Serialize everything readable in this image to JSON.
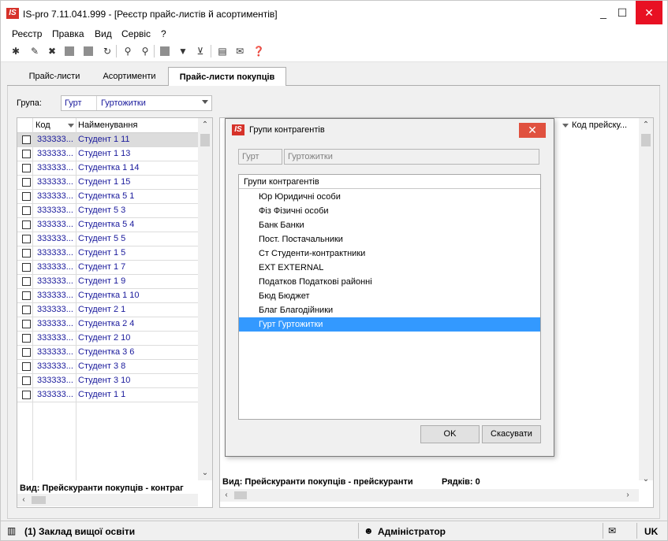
{
  "window": {
    "title": "IS-pro 7.11.041.999 - [Реєстр прайс-листів й асортиментів]",
    "logo": "IS",
    "minimize_icon": "_",
    "maximize_icon": "☐",
    "close_icon": "✕"
  },
  "menu": [
    "Реєстр",
    "Правка",
    "Вид",
    "Сервіс",
    "?"
  ],
  "tabs": [
    "Прайс-листи",
    "Асортименти",
    "Прайс-листи покупців"
  ],
  "group": {
    "label": "Група:",
    "code": "Гурт",
    "name": "Гуртожитки"
  },
  "left_grid": {
    "columns": [
      "Код",
      "Найменування"
    ],
    "rows": [
      {
        "code": "333333...",
        "name": "Студент 1 11"
      },
      {
        "code": "333333...",
        "name": "Студент 1 13"
      },
      {
        "code": "333333...",
        "name": "Студентка 1 14"
      },
      {
        "code": "333333...",
        "name": "Студент 1 15"
      },
      {
        "code": "333333...",
        "name": "Студентка 5 1"
      },
      {
        "code": "333333...",
        "name": "Студент 5 3"
      },
      {
        "code": "333333...",
        "name": "Студентка 5 4"
      },
      {
        "code": "333333...",
        "name": "Студент 5 5"
      },
      {
        "code": "333333...",
        "name": "Студент 1 5"
      },
      {
        "code": "333333...",
        "name": "Студент 1 7"
      },
      {
        "code": "333333...",
        "name": "Студент 1 9"
      },
      {
        "code": "333333...",
        "name": "Студентка 1 10"
      },
      {
        "code": "333333...",
        "name": "Студент 2 1"
      },
      {
        "code": "333333...",
        "name": "Студентка 2 4"
      },
      {
        "code": "333333...",
        "name": "Студент 2 10"
      },
      {
        "code": "333333...",
        "name": "Студентка 3 6"
      },
      {
        "code": "333333...",
        "name": "Студент 3 8"
      },
      {
        "code": "333333...",
        "name": "Студент 3 10"
      },
      {
        "code": "333333...",
        "name": "Студент 1 1"
      }
    ],
    "footer": "Вид: Прейскуранти покупців - контраг"
  },
  "right_grid": {
    "column": "Код прейску...",
    "footer_view": "Вид: Прейскуранти покупців - прейскуранти",
    "footer_rows": "Рядків: 0"
  },
  "dialog": {
    "title": "Групи контрагентів",
    "code": "Гурт",
    "name": "Гуртожитки",
    "list_header": "Групи контрагентів",
    "items": [
      "Юр Юридичні особи",
      "Фіз Фізичні особи",
      "Банк Банки",
      "Пост. Постачальники",
      "Ст Студенти-контрактники",
      "EXT EXTERNAL",
      "Податков Податкові районні",
      "Бюд Бюджет",
      "Благ Благодійники",
      "Гурт Гуртожитки"
    ],
    "selected_index": 9,
    "ok": "OK",
    "cancel": "Скасувати"
  },
  "status": {
    "org": "(1) Заклад вищої освіти",
    "user": "Адміністратор",
    "lang": "UK"
  },
  "colors": {
    "accent_red": "#d6322a",
    "link_blue": "#1a1a9c",
    "selection_blue": "#3399ff"
  }
}
